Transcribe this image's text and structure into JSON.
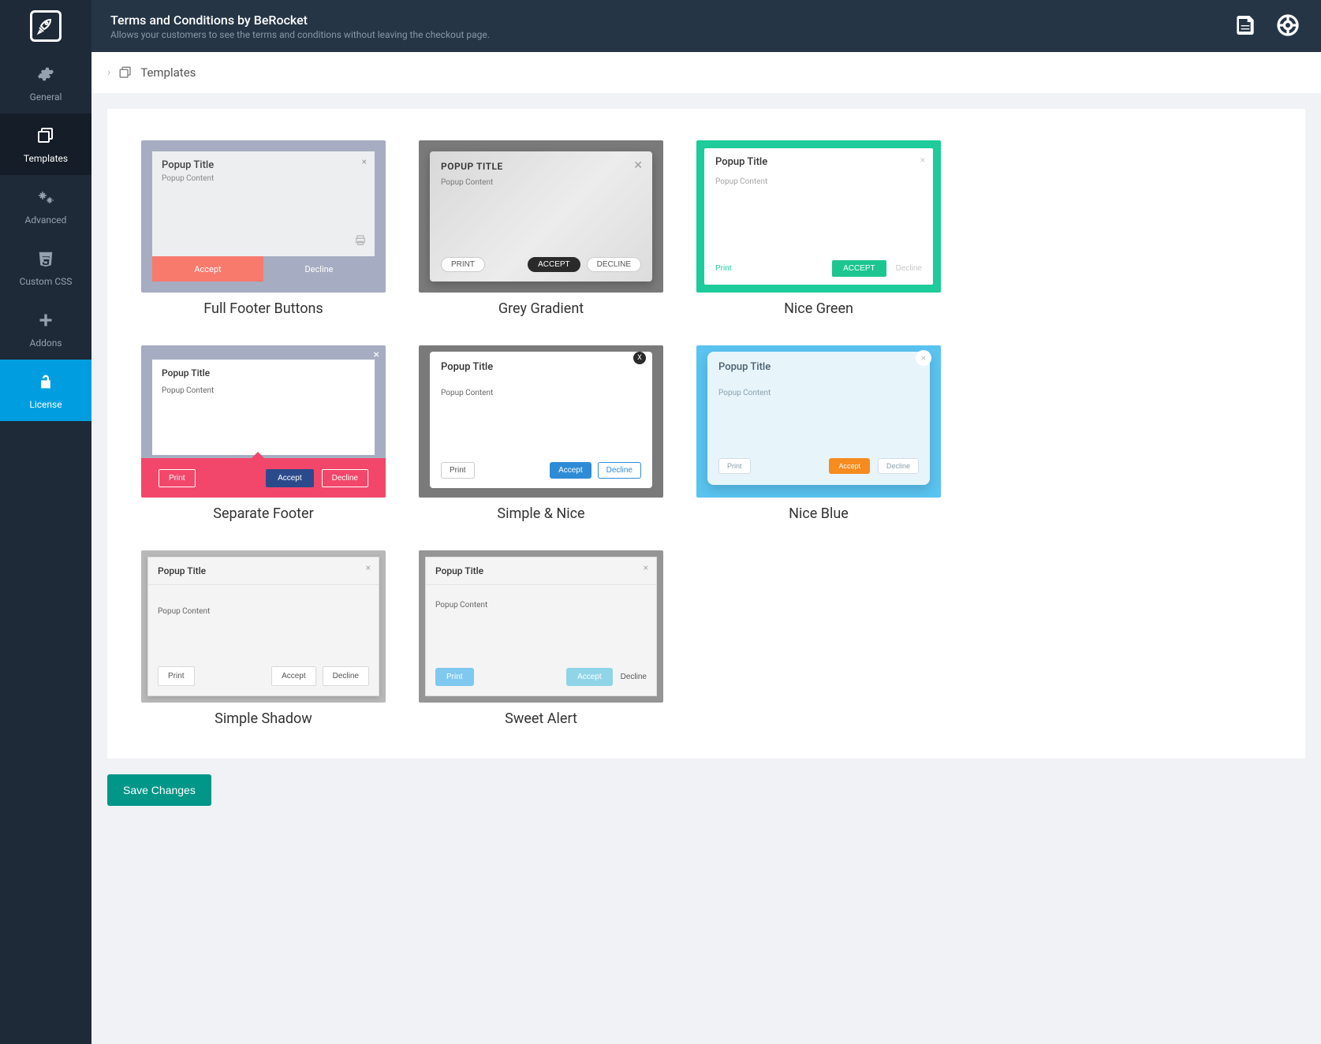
{
  "header": {
    "title": "Terms and Conditions by BeRocket",
    "subtitle": "Allows your customers to see the terms and conditions without leaving the checkout page."
  },
  "sidebar": {
    "items": [
      {
        "label": "General"
      },
      {
        "label": "Templates"
      },
      {
        "label": "Advanced"
      },
      {
        "label": "Custom CSS"
      },
      {
        "label": "Addons"
      },
      {
        "label": "License"
      }
    ]
  },
  "breadcrumb": {
    "label": "Templates"
  },
  "templates": [
    {
      "name": "Full Footer Buttons",
      "popup_title": "Popup Title",
      "popup_content": "Popup Content",
      "accept": "Accept",
      "decline": "Decline"
    },
    {
      "name": "Grey Gradient",
      "popup_title": "POPUP TITLE",
      "popup_content": "Popup Content",
      "print": "PRINT",
      "accept": "ACCEPT",
      "decline": "DECLINE"
    },
    {
      "name": "Nice Green",
      "popup_title": "Popup Title",
      "popup_content": "Popup Content",
      "print": "Print",
      "accept": "ACCEPT",
      "decline": "Decline"
    },
    {
      "name": "Separate Footer",
      "popup_title": "Popup Title",
      "popup_content": "Popup Content",
      "print": "Print",
      "accept": "Accept",
      "decline": "Decline"
    },
    {
      "name": "Simple & Nice",
      "popup_title": "Popup Title",
      "popup_content": "Popup Content",
      "print": "Print",
      "accept": "Accept",
      "decline": "Decline",
      "close": "X"
    },
    {
      "name": "Nice Blue",
      "popup_title": "Popup Title",
      "popup_content": "Popup Content",
      "print": "Print",
      "accept": "Accept",
      "decline": "Decline"
    },
    {
      "name": "Simple Shadow",
      "popup_title": "Popup Title",
      "popup_content": "Popup Content",
      "print": "Print",
      "accept": "Accept",
      "decline": "Decline"
    },
    {
      "name": "Sweet Alert",
      "popup_title": "Popup Title",
      "popup_content": "Popup Content",
      "print": "Print",
      "accept": "Accept",
      "decline": "Decline"
    }
  ],
  "actions": {
    "save": "Save Changes"
  }
}
